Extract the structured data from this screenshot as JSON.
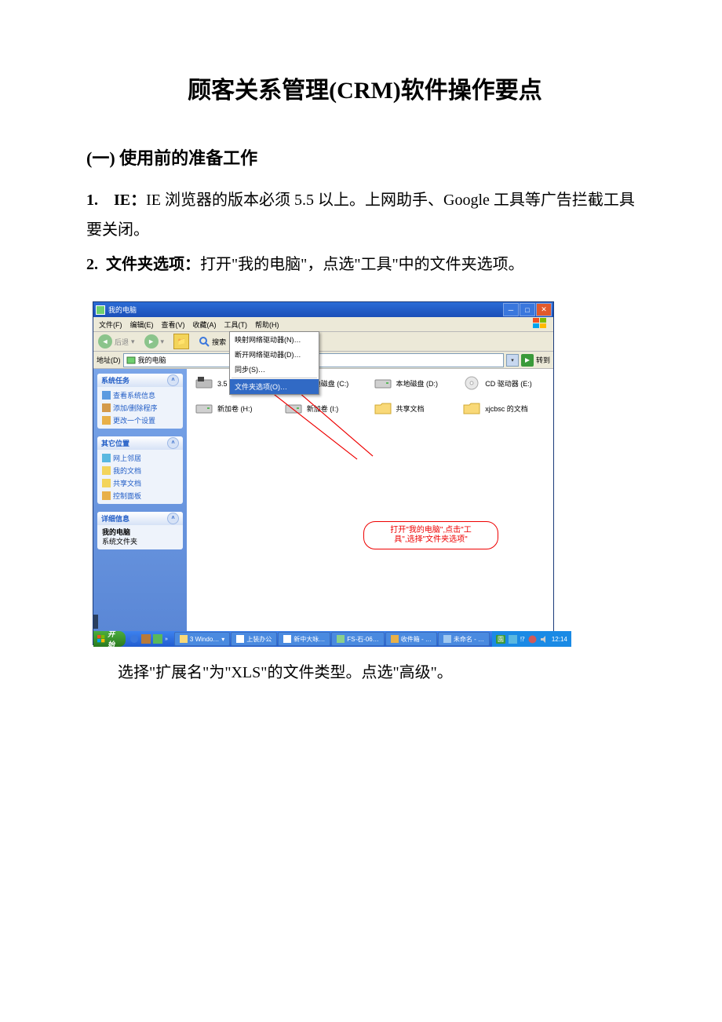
{
  "title": "顾客关系管理(CRM)软件操作要点",
  "section1_heading": "(一) 使用前的准备工作",
  "p1_num": "1.",
  "p1_label": "IE：",
  "p1_text": "IE 浏览器的版本必须 5.5 以上。上网助手、Google 工具等广告拦截工具要关闭。",
  "p2_num": "2.",
  "p2_label": "文件夹选项：",
  "p2_text": "打开\"我的电脑\"，点选\"工具\"中的文件夹选项。",
  "caption": "选择\"扩展名\"为\"XLS\"的文件类型。点选\"高级\"。",
  "screenshot": {
    "window_title": "我的电脑",
    "menu": {
      "file": "文件(F)",
      "edit": "编辑(E)",
      "view": "查看(V)",
      "favorites": "收藏(A)",
      "tools": "工具(T)",
      "help": "帮助(H)"
    },
    "toolbar": {
      "back": "后退",
      "search": "搜索"
    },
    "address": {
      "label": "地址(D)",
      "value": "我的电脑",
      "go": "转到"
    },
    "tools_menu": {
      "item1": "映射网络驱动器(N)…",
      "item2": "断开网络驱动器(D)…",
      "item3": "同步(S)…",
      "item4": "文件夹选项(O)…"
    },
    "sidebar": {
      "p1_title": "系统任务",
      "p1_items": [
        "查看系统信息",
        "添加/删除程序",
        "更改一个设置"
      ],
      "p2_title": "其它位置",
      "p2_items": [
        "网上邻居",
        "我的文档",
        "共享文档",
        "控制面板"
      ],
      "p3_title": "详细信息",
      "p3_name": "我的电脑",
      "p3_sub": "系统文件夹"
    },
    "drives": [
      {
        "label": "3.5 软盘 (A:)"
      },
      {
        "label": "本地磁盘 (C:)"
      },
      {
        "label": "本地磁盘 (D:)"
      },
      {
        "label": "CD 驱动器 (E:)"
      },
      {
        "label": "新加卷 (H:)"
      },
      {
        "label": "新加卷 (I:)"
      },
      {
        "label": "共享文档"
      },
      {
        "label": "xjcbsc 的文档"
      }
    ],
    "callout_line1": "打开\"我的电脑\",点击\"工",
    "callout_line2": "具\",选择\"文件夹选项\"",
    "taskbar": {
      "start": "开始",
      "tasks": [
        "3 Windo…",
        "上装办公",
        "新中大咏…",
        "FS-石-06…",
        "收件箱 - …",
        "未命名 - …"
      ],
      "time": "12:14"
    }
  }
}
